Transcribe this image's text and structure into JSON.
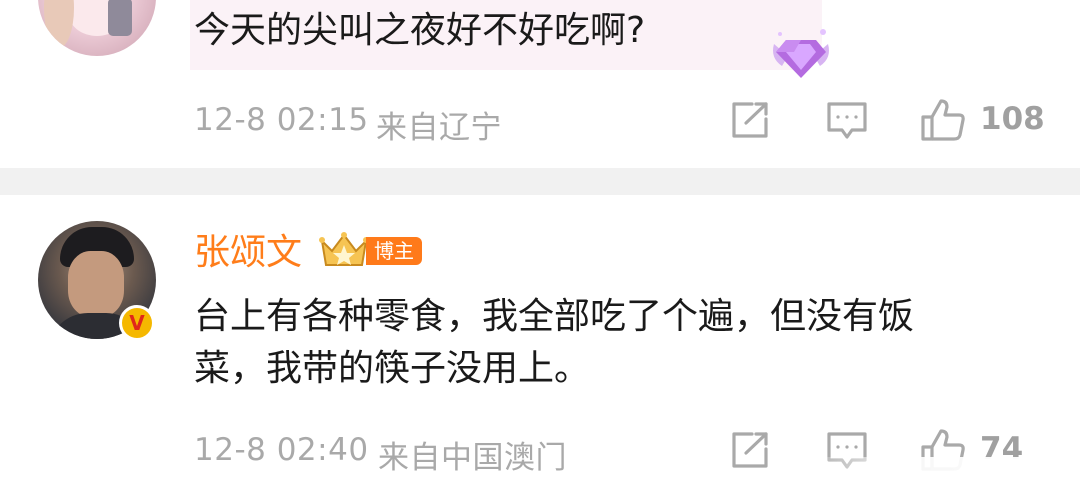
{
  "comment1": {
    "text": "今天的尖叫之夜好不好吃啊?",
    "time": "12-8 02:15",
    "location": "来自辽宁",
    "like_count": "108",
    "colors": {
      "bubble": "#fbf2f7",
      "gem": "#b46be0"
    }
  },
  "comment2": {
    "username": "张颂文",
    "role_badge": "博主",
    "verified_badge": "V",
    "text_line1": "台上有各种零食，我全部吃了个遍，但没有饭",
    "text_line2": "菜，我带的筷子没用上。",
    "time": "12-8 02:40",
    "location": "来自中国澳门",
    "like_count": "74",
    "colors": {
      "username": "#ff7d1a",
      "verified": "#f5b800"
    }
  },
  "icons": {
    "share": "share-icon",
    "comment": "comment-icon",
    "like": "thumbs-up-icon",
    "crown": "crown-icon",
    "gem": "gem-badge-icon"
  }
}
